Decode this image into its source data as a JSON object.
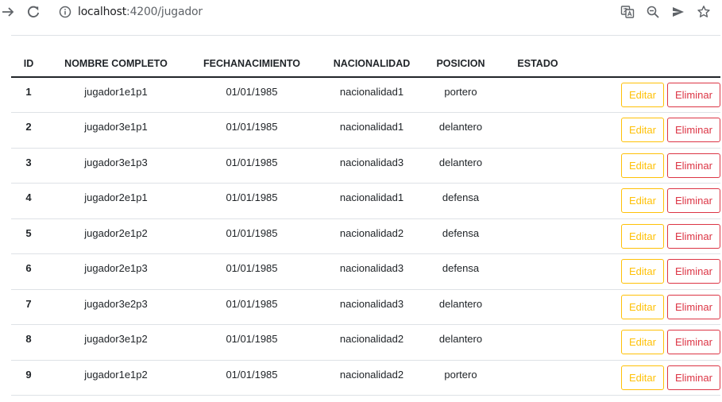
{
  "browser": {
    "url_host": "localhost",
    "url_rest": ":4200/jugador"
  },
  "table": {
    "headers": [
      "ID",
      "NOMBRE COMPLETO",
      "FECHANACIMIENTO",
      "NACIONALIDAD",
      "POSICION",
      "ESTADO"
    ],
    "edit_label": "Editar",
    "delete_label": "Eliminar",
    "rows": [
      {
        "id": "1",
        "nombre": "jugador1e1p1",
        "fecha": "01/01/1985",
        "nacionalidad": "nacionalidad1",
        "posicion": "portero",
        "estado": ""
      },
      {
        "id": "2",
        "nombre": "jugador3e1p1",
        "fecha": "01/01/1985",
        "nacionalidad": "nacionalidad1",
        "posicion": "delantero",
        "estado": ""
      },
      {
        "id": "3",
        "nombre": "jugador3e1p3",
        "fecha": "01/01/1985",
        "nacionalidad": "nacionalidad3",
        "posicion": "delantero",
        "estado": ""
      },
      {
        "id": "4",
        "nombre": "jugador2e1p1",
        "fecha": "01/01/1985",
        "nacionalidad": "nacionalidad1",
        "posicion": "defensa",
        "estado": ""
      },
      {
        "id": "5",
        "nombre": "jugador2e1p2",
        "fecha": "01/01/1985",
        "nacionalidad": "nacionalidad2",
        "posicion": "defensa",
        "estado": ""
      },
      {
        "id": "6",
        "nombre": "jugador2e1p3",
        "fecha": "01/01/1985",
        "nacionalidad": "nacionalidad3",
        "posicion": "defensa",
        "estado": ""
      },
      {
        "id": "7",
        "nombre": "jugador3e2p3",
        "fecha": "01/01/1985",
        "nacionalidad": "nacionalidad3",
        "posicion": "delantero",
        "estado": ""
      },
      {
        "id": "8",
        "nombre": "jugador3e1p2",
        "fecha": "01/01/1985",
        "nacionalidad": "nacionalidad2",
        "posicion": "delantero",
        "estado": ""
      },
      {
        "id": "9",
        "nombre": "jugador1e1p2",
        "fecha": "01/01/1985",
        "nacionalidad": "nacionalidad2",
        "posicion": "portero",
        "estado": ""
      }
    ]
  },
  "colors": {
    "edit": "#ffc107",
    "delete": "#dc3545"
  },
  "icons": [
    "forward-arrow-icon",
    "reload-icon",
    "info-icon",
    "translate-icon",
    "zoom-out-icon",
    "send-icon",
    "bookmark-star-icon"
  ]
}
